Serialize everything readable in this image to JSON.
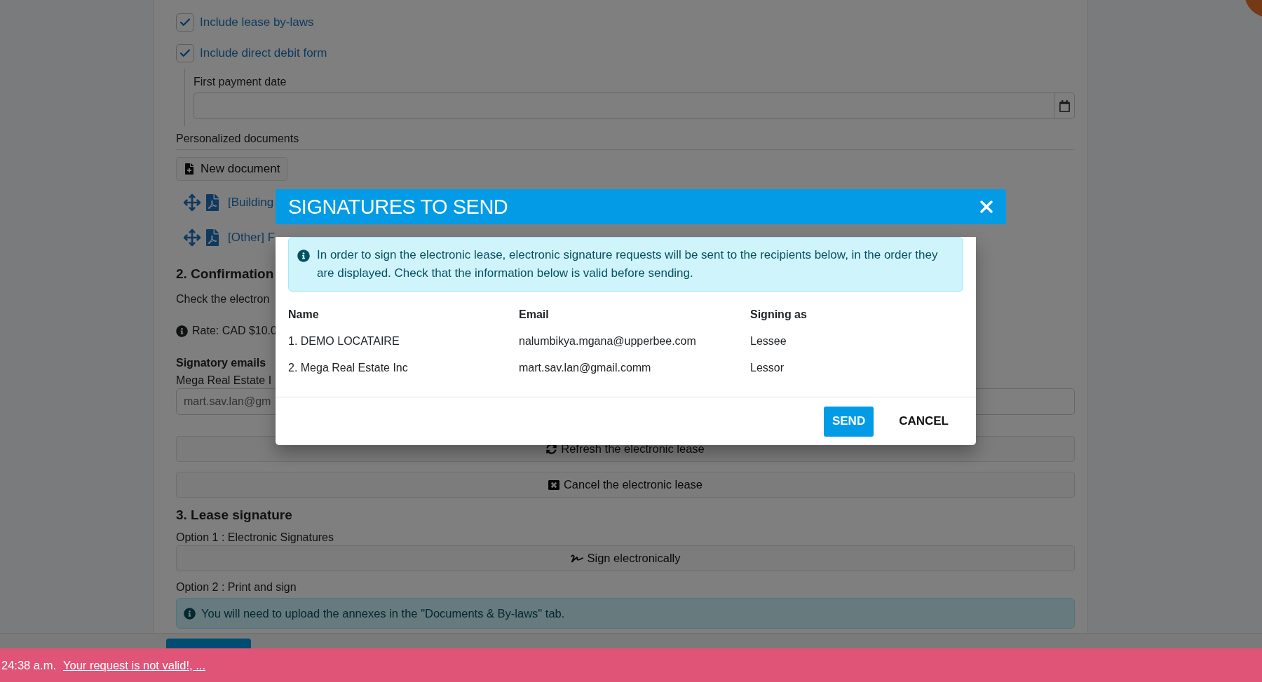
{
  "background_form": {
    "checkboxes": [
      {
        "label": "Include lease by-laws",
        "checked": true
      },
      {
        "label": "Include direct debit form",
        "checked": true
      }
    ],
    "first_payment_date": {
      "label": "First payment date"
    },
    "personalized_documents": {
      "title": "Personalized documents",
      "new_document_button": "New document",
      "documents": [
        "[Building",
        "[Other] F"
      ]
    },
    "confirmation": {
      "heading": "2. Confirmation",
      "description": "Check the electron",
      "rate": "Rate: CAD $10.0",
      "signatory_emails_heading": "Signatory emails",
      "signatory_name": "Mega Real Estate I",
      "signatory_email": "mart.sav.lan@gm",
      "refresh_button": "Refresh the electronic lease",
      "cancel_button": "Cancel the electronic lease"
    },
    "lease_signature": {
      "heading": "3. Lease signature",
      "option_1": "Option 1 : Electronic Signatures",
      "sign_button": "Sign electronically",
      "option_2": "Option 2 : Print and sign",
      "notice": "You will need to upload the annexes in the \"Documents & By-laws\" tab."
    }
  },
  "dialog": {
    "title": "SIGNATURES TO SEND",
    "info": "In order to sign the electronic lease, electronic signature requests will be sent to the recipients below, in the order they are displayed. Check that the information below is valid before sending.",
    "columns": [
      "Name",
      "Email",
      "Signing as"
    ],
    "rows": [
      [
        "1. DEMO LOCATAIRE",
        "nalumbikya.mgana@upperbee.com",
        "Lessee"
      ],
      [
        "2. Mega Real Estate Inc",
        "mart.sav.lan@gmail.comm",
        "Lessor"
      ]
    ],
    "buttons": [
      {
        "label": "SEND",
        "kind": "primary"
      },
      {
        "label": "CANCEL",
        "kind": "plain"
      }
    ]
  },
  "toast": {
    "time": "24:38 a.m.",
    "link": "Your request is not valid!, ..."
  }
}
